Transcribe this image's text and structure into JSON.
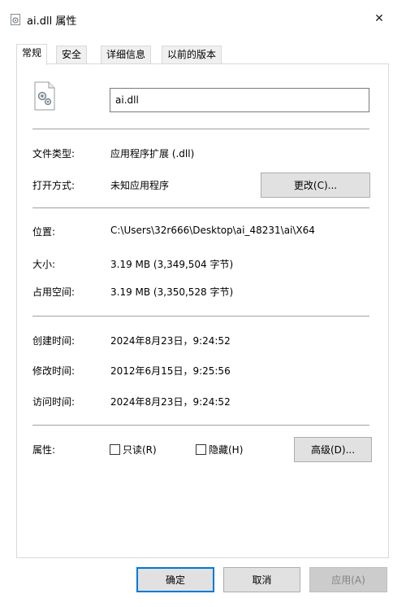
{
  "window": {
    "title": "ai.dll 属性",
    "close_glyph": "✕"
  },
  "tabs": [
    {
      "label": "常规",
      "active": true
    },
    {
      "label": "安全",
      "active": false
    },
    {
      "label": "详细信息",
      "active": false
    },
    {
      "label": "以前的版本",
      "active": false
    }
  ],
  "file": {
    "name": "ai.dll"
  },
  "type_section": {
    "file_type_label": "文件类型:",
    "file_type_value": "应用程序扩展 (.dll)",
    "opens_with_label": "打开方式:",
    "opens_with_value": "未知应用程序",
    "change_button": "更改(C)..."
  },
  "location_section": {
    "location_label": "位置:",
    "location_value": "C:\\Users\\32r666\\Desktop\\ai_48231\\ai\\X64",
    "size_label": "大小:",
    "size_value": "3.19 MB (3,349,504 字节)",
    "size_on_disk_label": "占用空间:",
    "size_on_disk_value": "3.19 MB (3,350,528 字节)"
  },
  "dates_section": {
    "created_label": "创建时间:",
    "created_value": "2024年8月23日，9:24:52",
    "modified_label": "修改时间:",
    "modified_value": "2012年6月15日，9:25:56",
    "accessed_label": "访问时间:",
    "accessed_value": "2024年8月23日，9:24:52"
  },
  "attributes": {
    "label": "属性:",
    "readonly_label": "只读(R)",
    "readonly_checked": false,
    "hidden_label": "隐藏(H)",
    "hidden_checked": false,
    "advanced_button": "高级(D)..."
  },
  "footer": {
    "ok_button": "确定",
    "cancel_button": "取消",
    "apply_button": "应用(A)"
  },
  "colors": {
    "accent": "#0078d7",
    "separator": "#a0a0a0",
    "tab_border": "#d9d9d9"
  }
}
